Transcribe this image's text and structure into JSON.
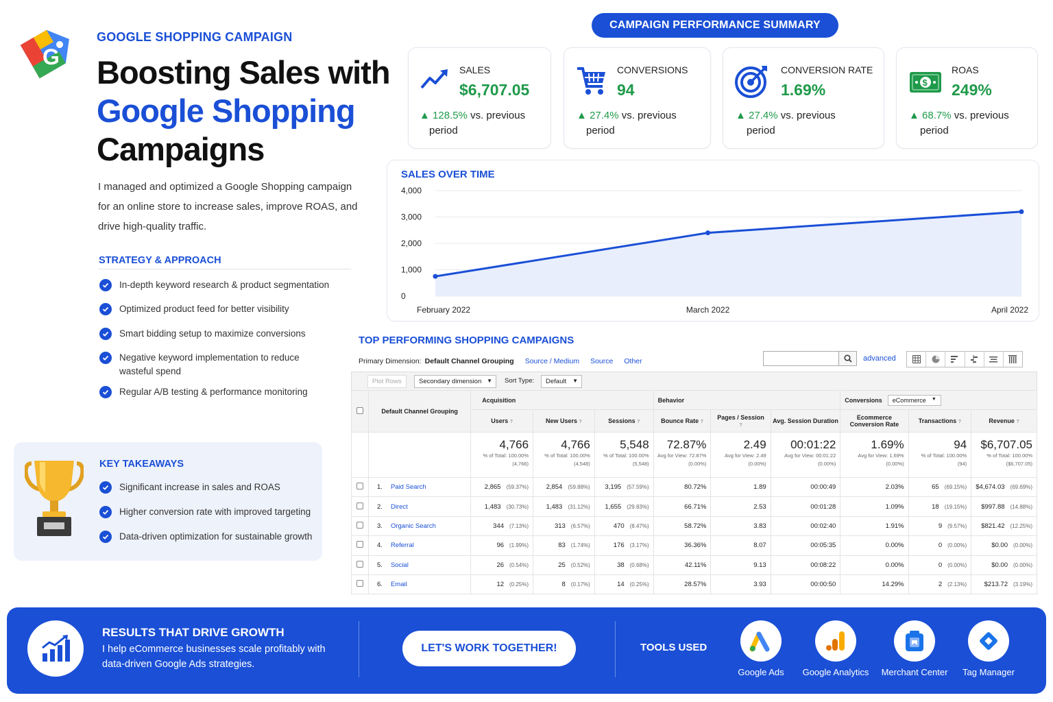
{
  "header": {
    "eyebrow": "GOOGLE SHOPPING CAMPAIGN",
    "title_line1": "Boosting Sales with",
    "title_line2": "Google Shopping",
    "title_line3": "Campaigns",
    "intro": "I managed and optimized a Google Shopping campaign for an online store to increase sales, improve ROAS, and drive high-quality traffic.",
    "logo_letter": "G"
  },
  "strategy": {
    "title": "STRATEGY & APPROACH",
    "items": [
      "In-depth keyword research & product segmentation",
      "Optimized product feed for better visibility",
      "Smart bidding setup to maximize conversions",
      "Negative keyword implementation to reduce wasteful spend",
      "Regular A/B testing & performance monitoring"
    ]
  },
  "takeaways": {
    "title": "KEY TAKEAWAYS",
    "items": [
      "Significant increase in sales and ROAS",
      "Higher conversion rate with improved targeting",
      "Data-driven optimization for sustainable growth"
    ]
  },
  "summary_pill": "CAMPAIGN PERFORMANCE SUMMARY",
  "kpis": [
    {
      "label": "SALES",
      "value": "$6,707.05",
      "change": "▲ 128.5%",
      "suffix_1": "vs. previous",
      "suffix_2": "period",
      "icon": "trend-up-icon"
    },
    {
      "label": "CONVERSIONS",
      "value": "94",
      "change": "▲ 27.4%",
      "suffix_1": "vs. previous",
      "suffix_2": "period",
      "icon": "cart-icon"
    },
    {
      "label": "CONVERSION RATE",
      "value": "1.69%",
      "change": "▲ 27.4%",
      "suffix_1": "vs. previous",
      "suffix_2": "period",
      "icon": "target-icon"
    },
    {
      "label": "ROAS",
      "value": "249%",
      "change": "▲ 68.7%",
      "suffix_1": "vs. previous",
      "suffix_2": "period",
      "icon": "money-icon"
    }
  ],
  "colors": {
    "accent": "#1a4fd6",
    "positive": "#1f9a4a"
  },
  "chart_data": {
    "type": "area",
    "title": "SALES OVER TIME",
    "categories": [
      "February 2022",
      "March 2022",
      "April 2022"
    ],
    "x_positions": [
      0,
      0.465,
      1
    ],
    "values": [
      750,
      2400,
      3200
    ],
    "yticks": [
      "4,000",
      "3,000",
      "2,000",
      "1,000",
      "0"
    ],
    "ylim": [
      0,
      4000
    ],
    "grid": true
  },
  "table": {
    "title": "TOP PERFORMING SHOPPING CAMPAIGNS",
    "primary_dimension_label": "Primary Dimension:",
    "primary_dimension": "Default Channel Grouping",
    "dim_links": [
      "Source / Medium",
      "Source",
      "Other"
    ],
    "advanced": "advanced",
    "plot_rows": "Plot Rows",
    "secondary_dimension": "Secondary dimension",
    "sort_type_label": "Sort Type:",
    "sort_type": "Default",
    "groups": {
      "acquisition": "Acquisition",
      "behavior": "Behavior",
      "conversions": "Conversions",
      "conv_select": "eCommerce"
    },
    "columns": [
      "Default Channel Grouping",
      "Users",
      "New Users",
      "Sessions",
      "Bounce Rate",
      "Pages / Session",
      "Avg. Session Duration",
      "Ecommerce Conversion Rate",
      "Transactions",
      "Revenue"
    ],
    "totals": [
      {
        "big": "4,766",
        "s1": "% of Total: 100.00%",
        "s2": "(4,766)"
      },
      {
        "big": "4,766",
        "s1": "% of Total: 100.00%",
        "s2": "(4,548)"
      },
      {
        "big": "5,548",
        "s1": "% of Total: 100.00%",
        "s2": "(5,548)"
      },
      {
        "big": "72.87%",
        "s1": "Avg for View: 72.87%",
        "s2": "(0.00%)"
      },
      {
        "big": "2.49",
        "s1": "Avg for View: 2.49",
        "s2": "(0.00%)"
      },
      {
        "big": "00:01:22",
        "s1": "Avg for View: 00:01:22",
        "s2": "(0.00%)"
      },
      {
        "big": "1.69%",
        "s1": "Avg for View: 1.69%",
        "s2": "(0.00%)"
      },
      {
        "big": "94",
        "s1": "% of Total: 100.00%",
        "s2": "(94)"
      },
      {
        "big": "$6,707.05",
        "s1": "% of Total: 100.00%",
        "s2": "($6,707.05)"
      }
    ],
    "rows": [
      {
        "idx": "1.",
        "name": "Paid Search",
        "users": "2,865",
        "users_p": "(59.37%)",
        "new": "2,854",
        "new_p": "(59.88%)",
        "sess": "3,195",
        "sess_p": "(57.59%)",
        "bounce": "80.72%",
        "pps": "1.89",
        "dur": "00:00:49",
        "cr": "2.03%",
        "tx": "65",
        "tx_p": "(69.15%)",
        "rev": "$4,674.03",
        "rev_p": "(69.69%)"
      },
      {
        "idx": "2.",
        "name": "Direct",
        "users": "1,483",
        "users_p": "(30.73%)",
        "new": "1,483",
        "new_p": "(31.12%)",
        "sess": "1,655",
        "sess_p": "(29.83%)",
        "bounce": "66.71%",
        "pps": "2.53",
        "dur": "00:01:28",
        "cr": "1.09%",
        "tx": "18",
        "tx_p": "(19.15%)",
        "rev": "$997.88",
        "rev_p": "(14.88%)"
      },
      {
        "idx": "3.",
        "name": "Organic Search",
        "users": "344",
        "users_p": "(7.13%)",
        "new": "313",
        "new_p": "(6.57%)",
        "sess": "470",
        "sess_p": "(8.47%)",
        "bounce": "58.72%",
        "pps": "3.83",
        "dur": "00:02:40",
        "cr": "1.91%",
        "tx": "9",
        "tx_p": "(9.57%)",
        "rev": "$821.42",
        "rev_p": "(12.25%)"
      },
      {
        "idx": "4.",
        "name": "Referral",
        "users": "96",
        "users_p": "(1.99%)",
        "new": "83",
        "new_p": "(1.74%)",
        "sess": "176",
        "sess_p": "(3.17%)",
        "bounce": "36.36%",
        "pps": "8.07",
        "dur": "00:05:35",
        "cr": "0.00%",
        "tx": "0",
        "tx_p": "(0.00%)",
        "rev": "$0.00",
        "rev_p": "(0.00%)"
      },
      {
        "idx": "5.",
        "name": "Social",
        "users": "26",
        "users_p": "(0.54%)",
        "new": "25",
        "new_p": "(0.52%)",
        "sess": "38",
        "sess_p": "(0.68%)",
        "bounce": "42.11%",
        "pps": "9.13",
        "dur": "00:08:22",
        "cr": "0.00%",
        "tx": "0",
        "tx_p": "(0.00%)",
        "rev": "$0.00",
        "rev_p": "(0.00%)"
      },
      {
        "idx": "6.",
        "name": "Email",
        "users": "12",
        "users_p": "(0.25%)",
        "new": "8",
        "new_p": "(0.17%)",
        "sess": "14",
        "sess_p": "(0.25%)",
        "bounce": "28.57%",
        "pps": "3.93",
        "dur": "00:00:50",
        "cr": "14.29%",
        "tx": "2",
        "tx_p": "(2.13%)",
        "rev": "$213.72",
        "rev_p": "(3.19%)"
      }
    ]
  },
  "footer": {
    "title": "RESULTS THAT DRIVE GROWTH",
    "subtitle": "I help eCommerce businesses scale profitably with data-driven Google Ads strategies.",
    "cta": "LET'S WORK TOGETHER!",
    "tools_label": "TOOLS USED",
    "tools": [
      "Google Ads",
      "Google Analytics",
      "Merchant Center",
      "Tag Manager"
    ]
  }
}
